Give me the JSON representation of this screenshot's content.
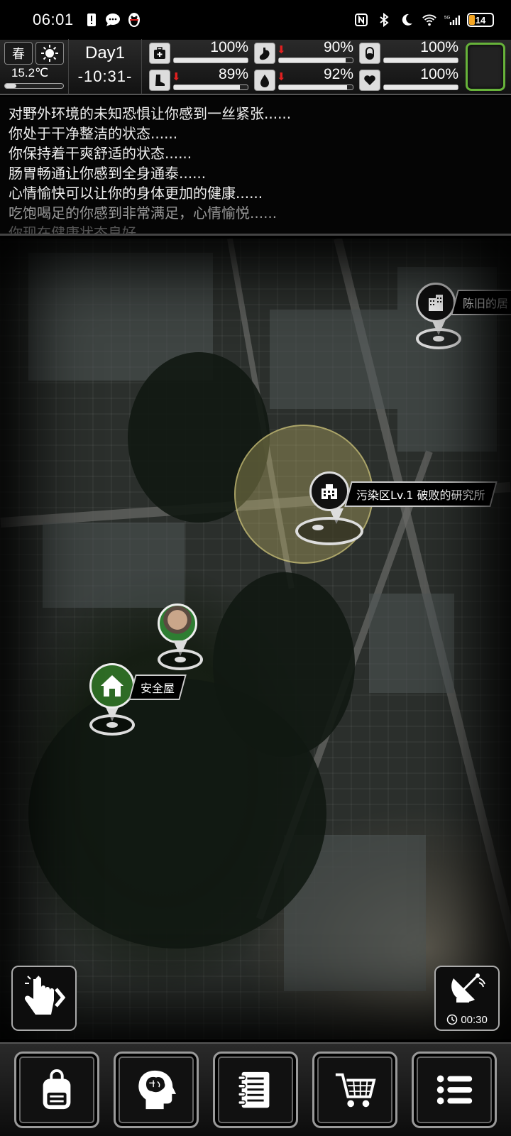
{
  "status_bar": {
    "time": "06:01",
    "battery": "14",
    "left_icons": [
      "sim-alert-icon",
      "chat-bubble-icon",
      "qq-penguin-icon"
    ],
    "right_icons": [
      "nfc-icon",
      "bluetooth-icon",
      "moon-icon",
      "wifi-icon",
      "5g-signal-icon",
      "battery-icon"
    ]
  },
  "hud": {
    "season": "春",
    "weather_icon": "sun-icon",
    "temperature": "15.2℃",
    "temperature_level": 0.2,
    "day": "Day1",
    "clock": "-10:31-",
    "stats": [
      {
        "name": "health",
        "icon": "medkit-icon",
        "value": "100%",
        "level": 1.0,
        "down": false
      },
      {
        "name": "hunger",
        "icon": "stomach-icon",
        "value": "90%",
        "level": 0.9,
        "down": true
      },
      {
        "name": "medicine",
        "icon": "pill-icon",
        "value": "100%",
        "level": 1.0,
        "down": false
      },
      {
        "name": "stamina",
        "icon": "boot-icon",
        "value": "89%",
        "level": 0.89,
        "down": true
      },
      {
        "name": "thirst",
        "icon": "water-drop-icon",
        "value": "92%",
        "level": 0.92,
        "down": true
      },
      {
        "name": "mood",
        "icon": "heart-icon",
        "value": "100%",
        "level": 1.0,
        "down": false
      }
    ],
    "slot_color": "#67b33a"
  },
  "log": [
    "对野外环境的未知恐惧让你感到一丝紧张......",
    "你处于干净整洁的状态......",
    "你保持着干爽舒适的状态......",
    "肠胃畅通让你感到全身通泰......",
    "心情愉快可以让你的身体更加的健康......",
    "吃饱喝足的你感到非常满足，心情愉悦......",
    "你现在健康状态良好......"
  ],
  "map": {
    "markers": [
      {
        "name": "old-building",
        "label": "陈旧的居"
      },
      {
        "name": "research-institute",
        "label": "污染区Lv.1 破败的研究所"
      },
      {
        "name": "safe-house",
        "label": "安全屋"
      }
    ],
    "player_icon": "player-portrait-icon",
    "zone_color": "#c8be6e"
  },
  "controls": {
    "tap_icon": "tap-hand-icon",
    "radar_icon": "satellite-dish-icon",
    "radar_timer": "00:30"
  },
  "bottom_nav": [
    {
      "name": "backpack",
      "icon": "backpack-icon"
    },
    {
      "name": "skills",
      "icon": "brain-head-icon"
    },
    {
      "name": "journal",
      "icon": "notebook-icon"
    },
    {
      "name": "shop",
      "icon": "cart-icon"
    },
    {
      "name": "menu",
      "icon": "menu-list-icon"
    }
  ]
}
